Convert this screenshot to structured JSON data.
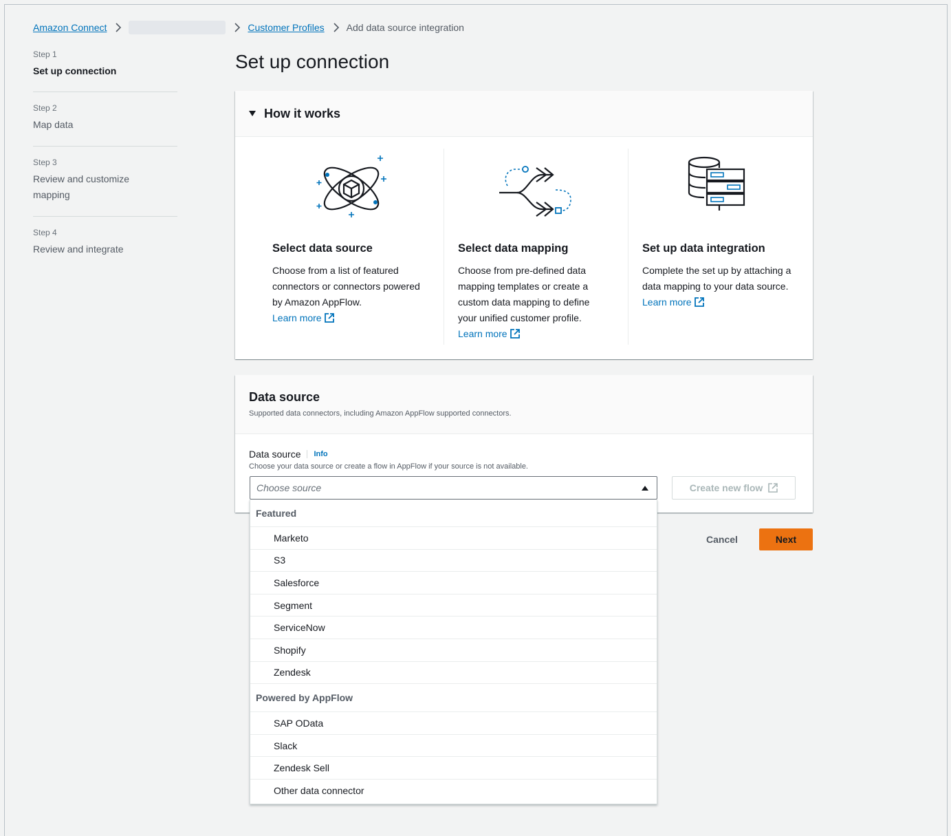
{
  "breadcrumb": {
    "amazon_connect": "Amazon Connect",
    "customer_profiles": "Customer Profiles",
    "current": "Add data source integration"
  },
  "wizard": {
    "steps": [
      {
        "number": "Step 1",
        "title": "Set up connection"
      },
      {
        "number": "Step 2",
        "title": "Map data"
      },
      {
        "number": "Step 3",
        "title": "Review and customize mapping"
      },
      {
        "number": "Step 4",
        "title": "Review and integrate"
      }
    ]
  },
  "page_title": "Set up connection",
  "how_it_works": {
    "title": "How it works",
    "columns": [
      {
        "title": "Select data source",
        "text": "Choose from a list of featured connectors or connectors powered by Amazon AppFlow.",
        "link": "Learn more",
        "icon": "atom-cube-icon"
      },
      {
        "title": "Select data mapping",
        "text": "Choose from pre-defined data mapping templates or create a custom data mapping to define your unified customer profile.",
        "link": "Learn more",
        "icon": "mapping-arrows-icon"
      },
      {
        "title": "Set up data integration",
        "text": "Complete the set up by attaching a data mapping to your data source.",
        "link": "Learn more",
        "icon": "database-servers-icon"
      }
    ]
  },
  "data_source": {
    "title": "Data source",
    "description": "Supported data connectors, including Amazon AppFlow supported connectors.",
    "field_label": "Data source",
    "info_link": "Info",
    "field_description": "Choose your data source or create a flow in AppFlow if your source is not available.",
    "placeholder": "Choose source",
    "create_flow_label": "Create new flow"
  },
  "dropdown": {
    "featured_label": "Featured",
    "featured": [
      "Marketo",
      "S3",
      "Salesforce",
      "Segment",
      "ServiceNow",
      "Shopify",
      "Zendesk"
    ],
    "appflow_label": "Powered by AppFlow",
    "appflow": [
      "SAP OData",
      "Slack",
      "Zendesk Sell",
      "Other data connector"
    ]
  },
  "actions": {
    "cancel": "Cancel",
    "next": "Next"
  },
  "colors": {
    "link": "#0073bb",
    "primary_button": "#ec7211",
    "page_background": "#f2f3f3",
    "illustration_accent": "#0073bb"
  }
}
